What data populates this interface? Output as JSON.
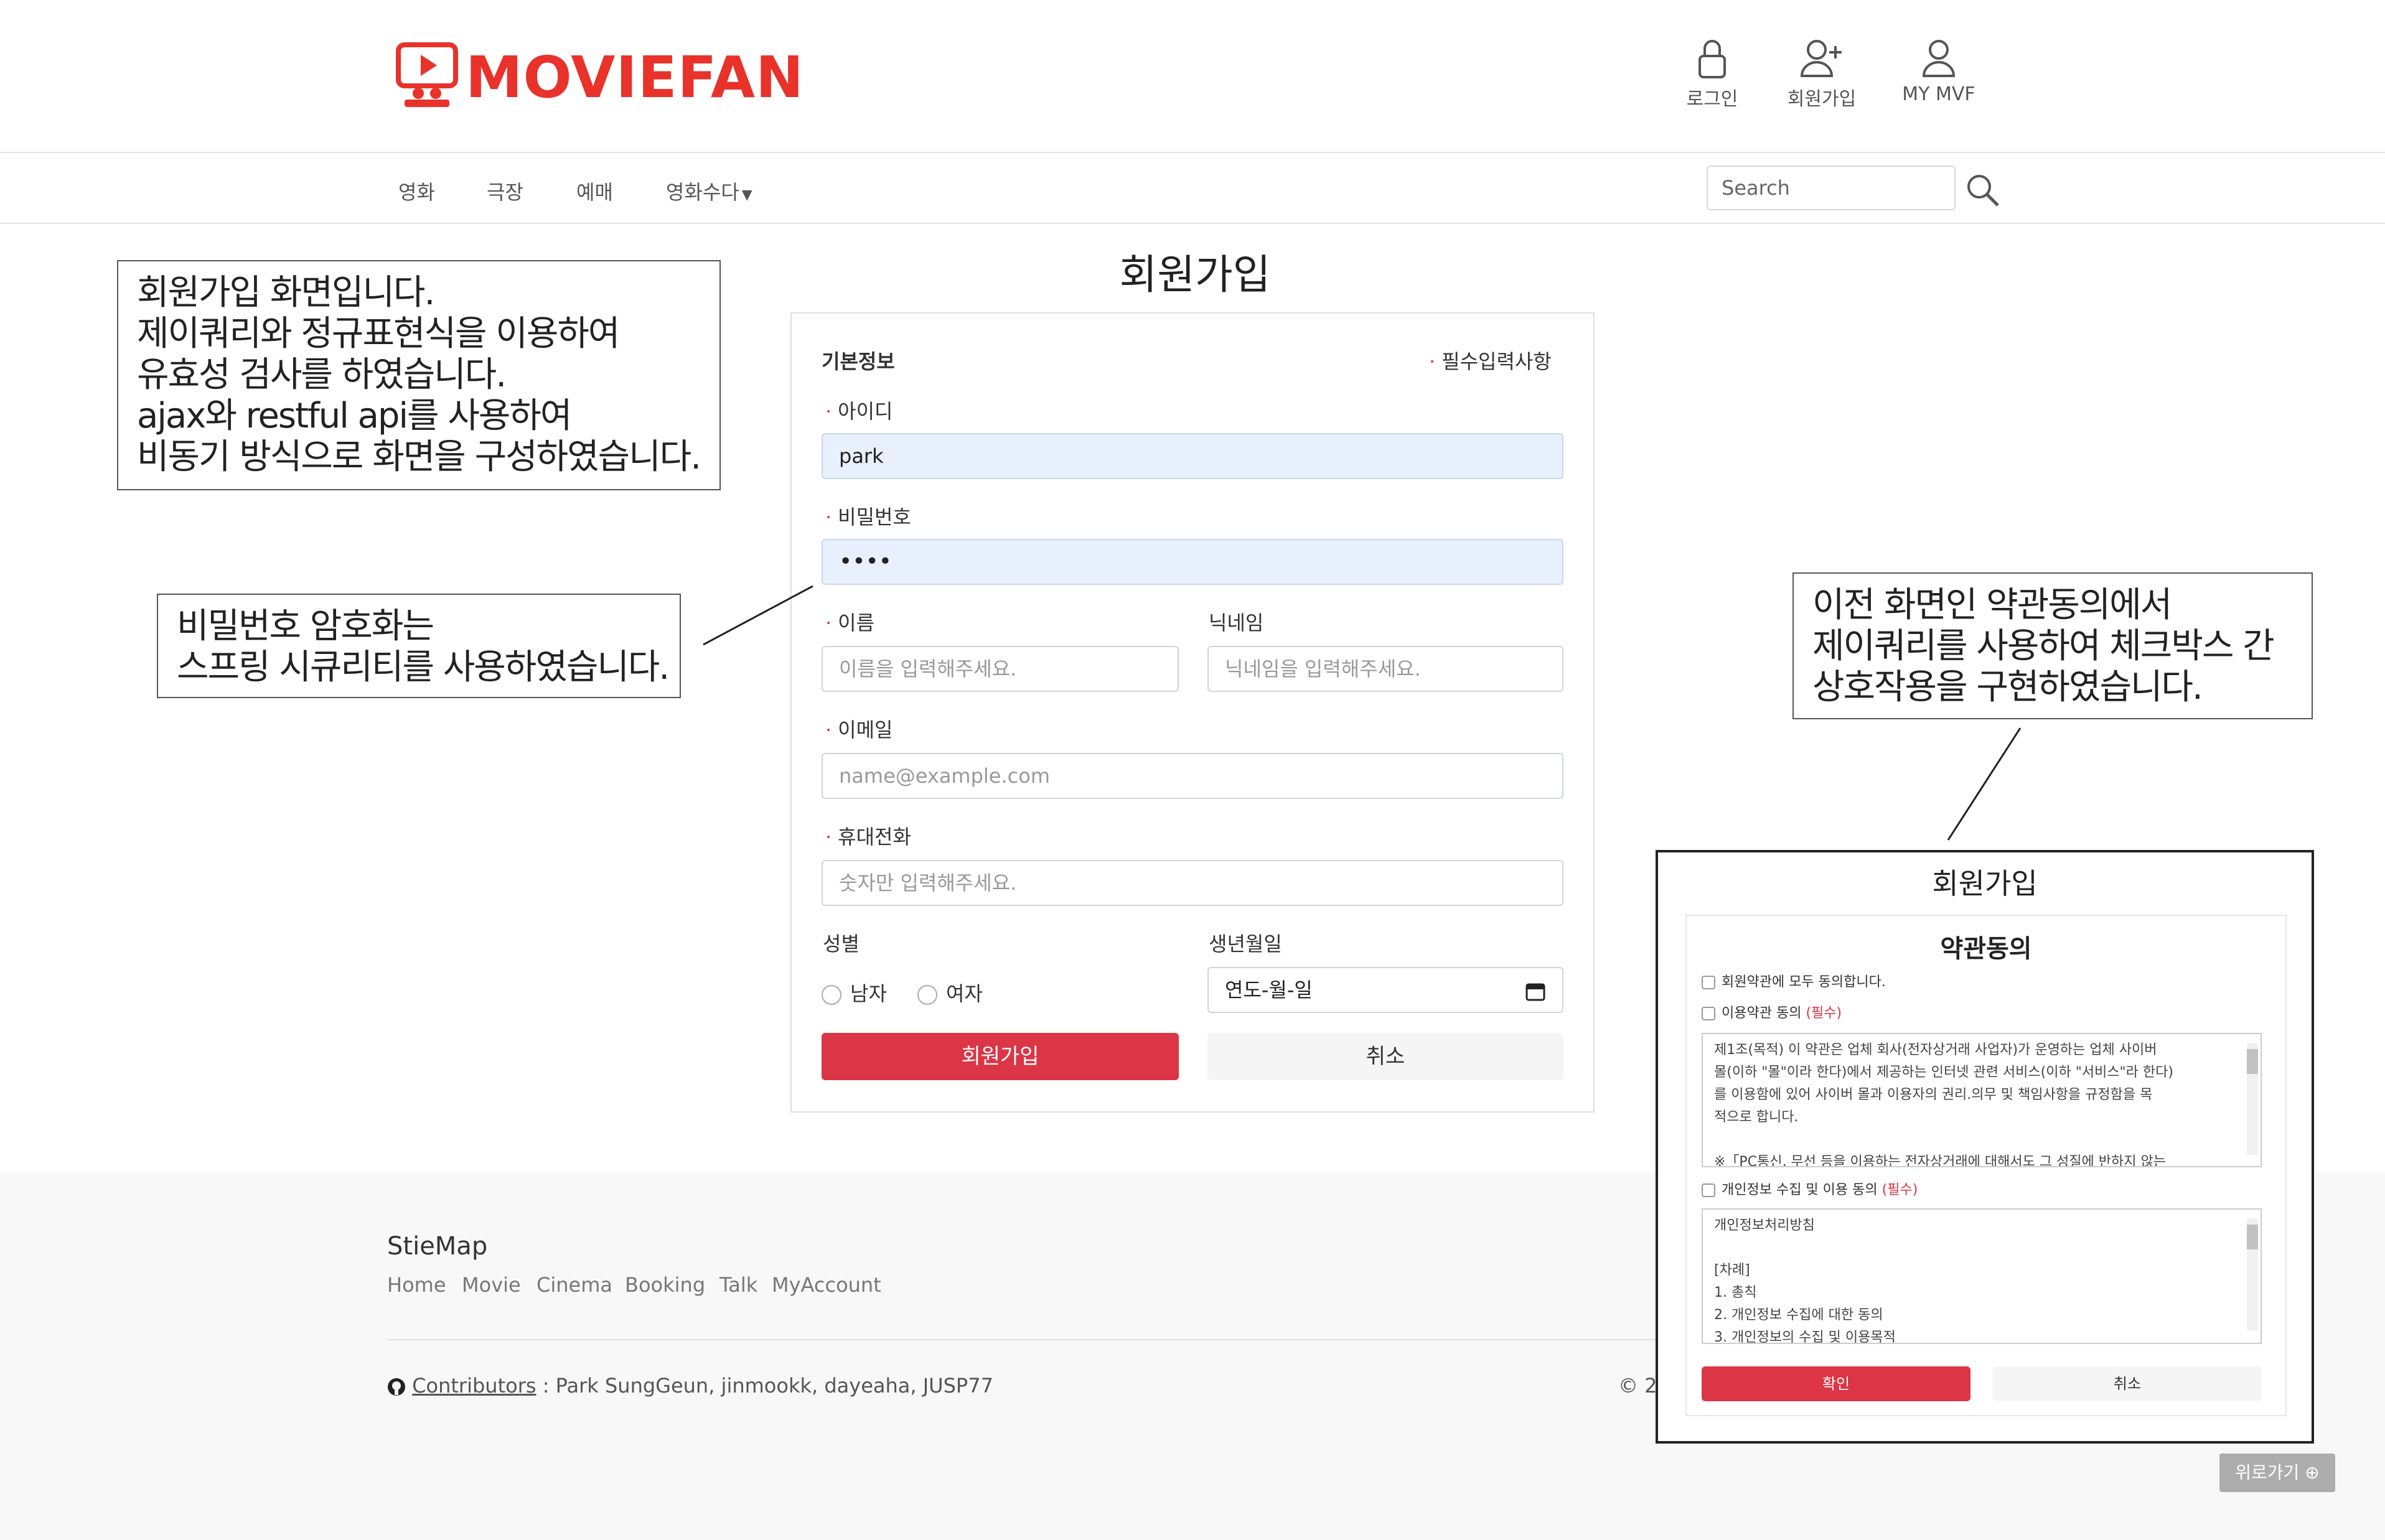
{
  "header": {
    "logo_text": "MOVIEFAN",
    "utility": [
      {
        "label": "로그인",
        "icon": "lock-icon"
      },
      {
        "label": "회원가입",
        "icon": "user-add-icon"
      },
      {
        "label": "MY MVF",
        "icon": "user-icon"
      }
    ]
  },
  "nav": {
    "items": [
      "영화",
      "극장",
      "예매",
      "영화수다"
    ],
    "search_placeholder": "Search"
  },
  "form": {
    "title": "회원가입",
    "section_label": "기본정보",
    "required_note": "필수입력사항",
    "required_mark": "·",
    "id_label": "아이디",
    "id_value": "park",
    "pw_label": "비밀번호",
    "pw_value": "••••",
    "name_label": "이름",
    "name_placeholder": "이름을 입력해주세요.",
    "nick_label": "닉네임",
    "nick_placeholder": "닉네임을 입력해주세요.",
    "email_label": "이메일",
    "email_placeholder": "name@example.com",
    "phone_label": "휴대전화",
    "phone_placeholder": "숫자만 입력해주세요.",
    "gender_label": "성별",
    "gender_male": "남자",
    "gender_female": "여자",
    "birth_label": "생년월일",
    "birth_value": "연도-월-일",
    "submit_label": "회원가입",
    "cancel_label": "취소"
  },
  "notes": {
    "note1": [
      "회원가입 화면입니다.",
      "제이쿼리와 정규표현식을 이용하여",
      "유효성 검사를 하였습니다.",
      "ajax와 restful api를 사용하여",
      "비동기 방식으로 화면을 구성하였습니다."
    ],
    "note2": [
      "비밀번호 암호화는",
      "스프링 시큐리티를 사용하였습니다."
    ],
    "note3": [
      "이전 화면인 약관동의에서",
      "제이쿼리를 사용하여 체크박스 간",
      "상호작용을 구현하였습니다."
    ]
  },
  "footer": {
    "title": "StieMap",
    "links": [
      "Home",
      "Movie",
      "Cinema",
      "Booking",
      "Talk",
      "MyAccount"
    ],
    "contrib_label": "Contributors",
    "contrib_names": ": Park SungGeun, jinmookk, dayeaha, JUSP77",
    "copyright_partial": "© 2"
  },
  "inset": {
    "title": "회원가입",
    "subtitle": "약관동의",
    "all_agree": "회원약관에 모두 동의합니다.",
    "terms_agree": "이용약관 동의",
    "privacy_agree": "개인정보 수집 및 이용 동의",
    "required_tag": "(필수)",
    "terms_text": [
      "제1조(목적) 이 약관은 업체 회사(전자상거래 사업자)가 운영하는 업체 사이버",
      "몰(이하 \"몰\"이라 한다)에서 제공하는 인터넷 관련 서비스(이하 \"서비스\"라 한다)",
      "를 이용함에 있어 사이버 몰과 이용자의 권리.의무 및 책임사항을 규정함을 목",
      "적으로 합니다.",
      "",
      "  ※「PC통신, 무선 등을 이용하는 전자상거래에 대해서도 그 성질에 반하지 않는"
    ],
    "privacy_text": [
      "개인정보처리방침",
      "",
      "[차례]",
      "1. 총칙",
      "2. 개인정보 수집에 대한 동의",
      "3. 개인정보의 수집 및 이용목적"
    ],
    "confirm_label": "확인",
    "cancel_label": "취소"
  },
  "to_top": "위로가기",
  "colors": {
    "brand": "#e8322a",
    "submit": "#dc3545",
    "filled_bg": "#e8f0fe"
  }
}
